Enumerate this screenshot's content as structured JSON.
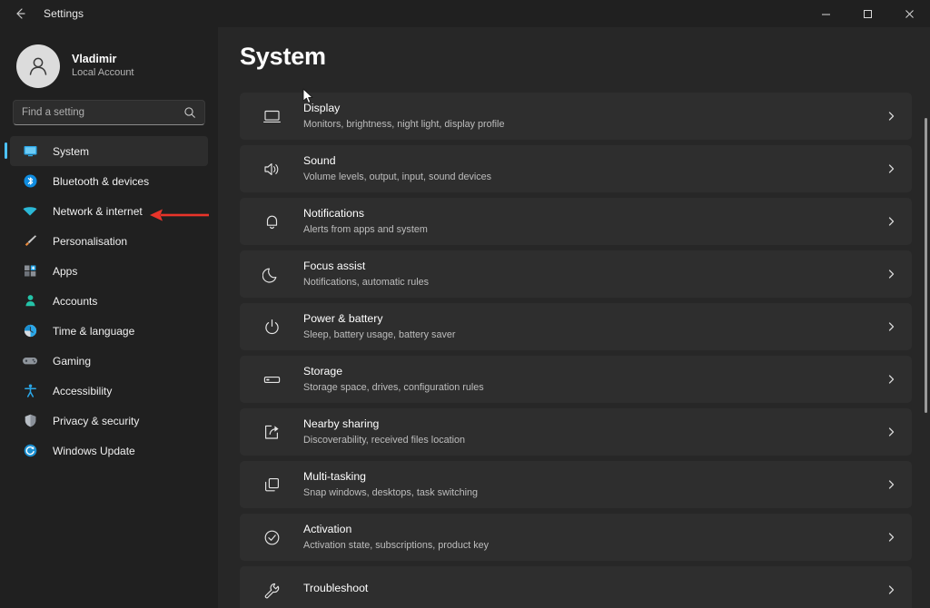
{
  "window": {
    "title": "Settings",
    "back_icon": "back-arrow-icon",
    "controls": {
      "minimize": "─",
      "maximize": "□",
      "close": "✕"
    }
  },
  "account": {
    "name": "Vladimir",
    "type": "Local Account",
    "avatar_icon": "user-avatar-icon"
  },
  "search": {
    "placeholder": "Find a setting",
    "value": "",
    "icon": "search-icon"
  },
  "sidebar": {
    "items": [
      {
        "label": "System",
        "icon": "monitor-icon",
        "active": true
      },
      {
        "label": "Bluetooth & devices",
        "icon": "bluetooth-icon",
        "active": false
      },
      {
        "label": "Network & internet",
        "icon": "wifi-icon",
        "active": false
      },
      {
        "label": "Personalisation",
        "icon": "paintbrush-icon",
        "active": false
      },
      {
        "label": "Apps",
        "icon": "apps-grid-icon",
        "active": false
      },
      {
        "label": "Accounts",
        "icon": "person-icon",
        "active": false
      },
      {
        "label": "Time & language",
        "icon": "clock-icon",
        "active": false
      },
      {
        "label": "Gaming",
        "icon": "gamepad-icon",
        "active": false
      },
      {
        "label": "Accessibility",
        "icon": "accessibility-icon",
        "active": false
      },
      {
        "label": "Privacy & security",
        "icon": "shield-icon",
        "active": false
      },
      {
        "label": "Windows Update",
        "icon": "update-refresh-icon",
        "active": false
      }
    ]
  },
  "main": {
    "title": "System",
    "cards": [
      {
        "title": "Display",
        "sub": "Monitors, brightness, night light, display profile",
        "icon": "display-monitor-icon"
      },
      {
        "title": "Sound",
        "sub": "Volume levels, output, input, sound devices",
        "icon": "speaker-icon"
      },
      {
        "title": "Notifications",
        "sub": "Alerts from apps and system",
        "icon": "bell-icon"
      },
      {
        "title": "Focus assist",
        "sub": "Notifications, automatic rules",
        "icon": "moon-icon"
      },
      {
        "title": "Power & battery",
        "sub": "Sleep, battery usage, battery saver",
        "icon": "power-icon"
      },
      {
        "title": "Storage",
        "sub": "Storage space, drives, configuration rules",
        "icon": "storage-drive-icon"
      },
      {
        "title": "Nearby sharing",
        "sub": "Discoverability, received files location",
        "icon": "share-icon"
      },
      {
        "title": "Multi-tasking",
        "sub": "Snap windows, desktops, task switching",
        "icon": "windows-stack-icon"
      },
      {
        "title": "Activation",
        "sub": "Activation state, subscriptions, product key",
        "icon": "check-circle-icon"
      },
      {
        "title": "Troubleshoot",
        "sub": "",
        "icon": "wrench-icon"
      }
    ]
  },
  "annotation": {
    "arrow_color": "#e8342a",
    "points_to": "Bluetooth & devices"
  },
  "colors": {
    "accent": "#4cc2ff",
    "page_bg": "#272727",
    "sidebar_bg": "#202020",
    "card_bg": "#2e2e2e"
  }
}
